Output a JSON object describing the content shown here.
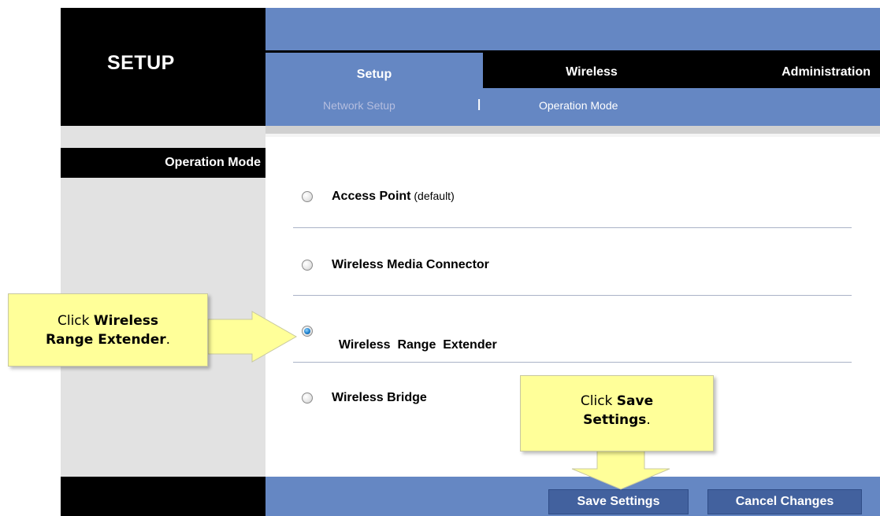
{
  "brand": {
    "title": "SETUP"
  },
  "tabs": [
    {
      "label": "Setup",
      "active": true
    },
    {
      "label": "Wireless",
      "active": false
    },
    {
      "label": "Administration",
      "active": false
    }
  ],
  "subtabs": {
    "network_setup": "Network Setup",
    "separator": "|",
    "operation_mode": "Operation Mode"
  },
  "sidebar": {
    "section_label": "Operation Mode"
  },
  "options": [
    {
      "label": "Access Point",
      "suffix": " (default)",
      "selected": false
    },
    {
      "label": "Wireless Media Connector",
      "suffix": "",
      "selected": false
    },
    {
      "label": "Wireless  Range  Extender",
      "suffix": "",
      "selected": true
    },
    {
      "label": "Wireless Bridge",
      "suffix": "",
      "selected": false
    }
  ],
  "buttons": {
    "save": "Save Settings",
    "cancel": "Cancel Changes"
  },
  "callouts": {
    "range_extender": {
      "prefix": "Click ",
      "bold_line1": "Wireless",
      "bold_line2": "Range Extender",
      "end": "."
    },
    "save_settings": {
      "prefix": "Click ",
      "bold_line1": "Save",
      "bold_line2": "Settings",
      "end": "."
    }
  },
  "colors": {
    "header_blue": "#6587c3",
    "button_blue": "#42619e",
    "callout_yellow": "#ffff99"
  }
}
